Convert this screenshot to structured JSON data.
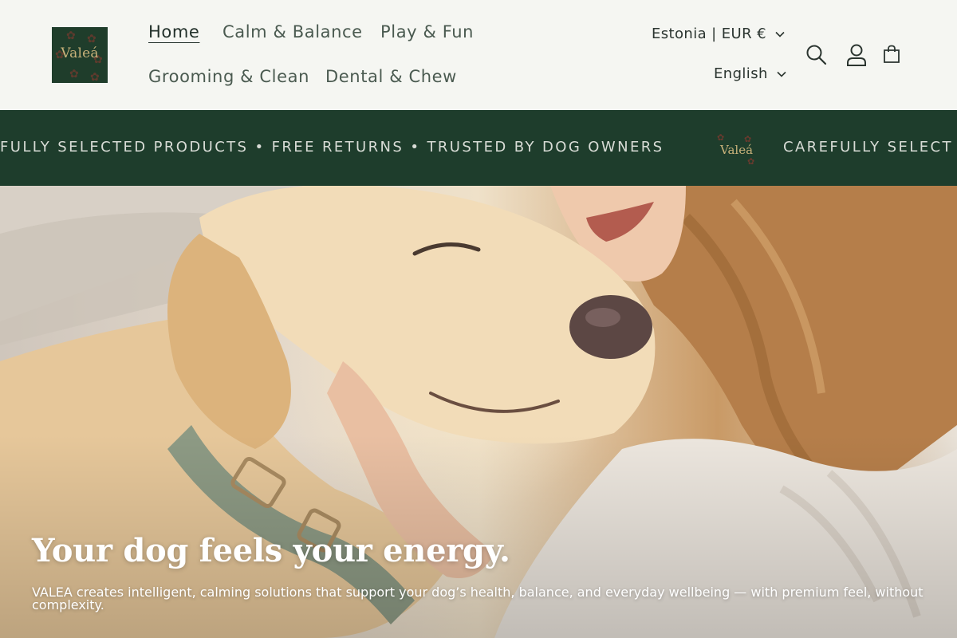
{
  "brand": {
    "logo_text": "Valeá"
  },
  "nav": {
    "items": [
      {
        "label": "Home",
        "active": true
      },
      {
        "label": "Calm & Balance"
      },
      {
        "label": "Play & Fun"
      },
      {
        "label": "Grooming & Clean"
      },
      {
        "label": "Dental & Chew"
      }
    ]
  },
  "locale": {
    "country_currency": "Estonia | EUR €",
    "language": "English"
  },
  "header_icons": [
    "search-icon",
    "account-icon",
    "cart-icon"
  ],
  "announcement": {
    "text_left": "FULLY SELECTED PRODUCTS • FREE RETURNS • TRUSTED BY DOG OWNERS",
    "logo_text": "Valeá",
    "text_right": "CAREFULLY SELECT"
  },
  "hero": {
    "title": "Your dog feels your energy.",
    "subtitle": "VALEA creates intelligent, calming solutions that support your dog’s health, balance, and everyday wellbeing — with premium feel, without complexity."
  },
  "colors": {
    "brand_green": "#1e3d2c",
    "background": "#f5f6f2",
    "text": "#4a5a50"
  }
}
